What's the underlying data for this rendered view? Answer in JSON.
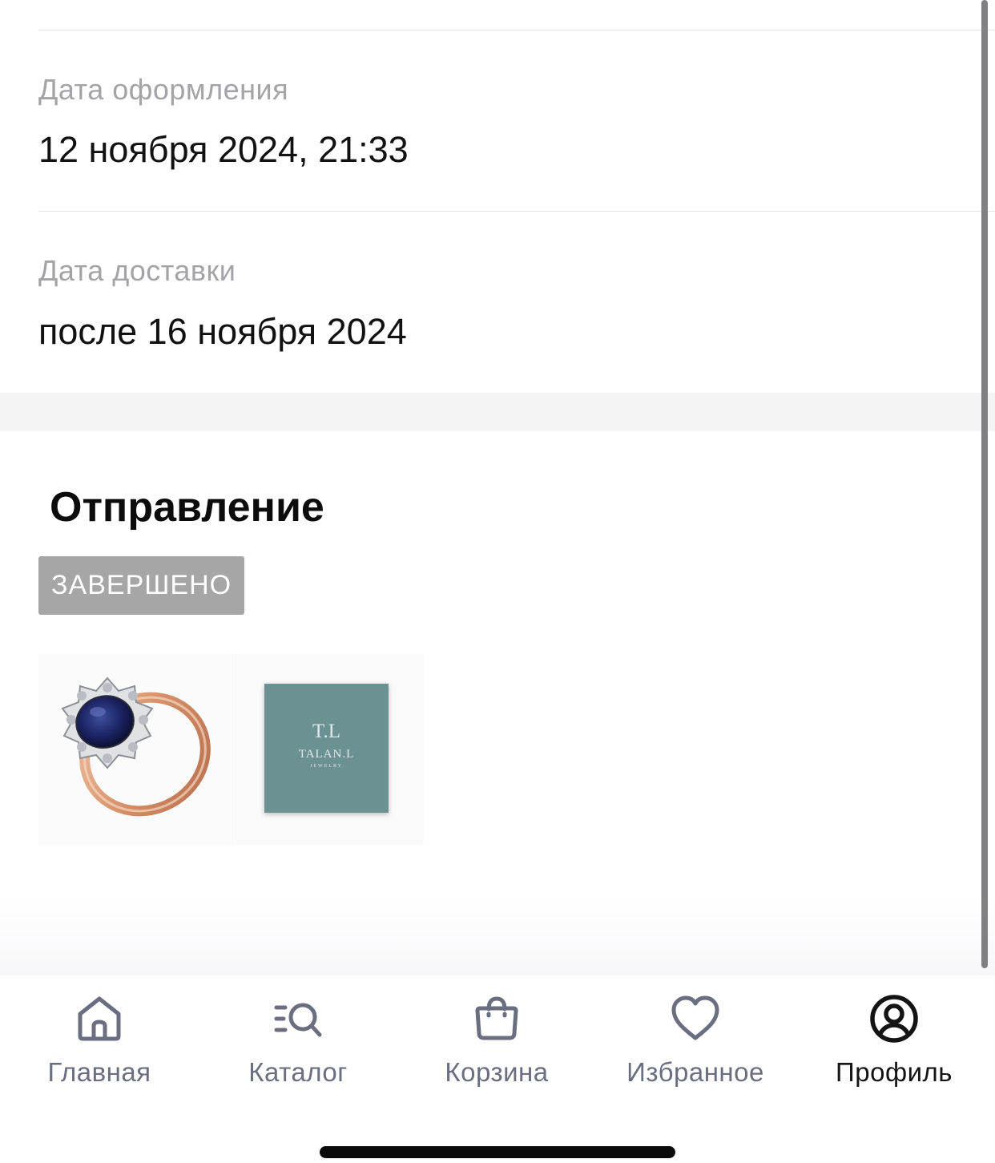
{
  "order_info": {
    "order_date_label": "Дата оформления",
    "order_date_value": "12 ноября 2024, 21:33",
    "delivery_date_label": "Дата доставки",
    "delivery_date_value": "после 16 ноября 2024"
  },
  "shipment": {
    "title": "Отправление",
    "status": "ЗАВЕРШЕНО",
    "items": [
      {
        "icon": "ring-image"
      },
      {
        "icon": "gift-box-image",
        "brand_monogram": "T.L",
        "brand_name": "TALAN.L",
        "brand_sub": "JEWELRY"
      }
    ]
  },
  "tabbar": {
    "items": [
      {
        "label": "Главная",
        "icon": "home-icon",
        "active": false
      },
      {
        "label": "Каталог",
        "icon": "catalog-search-icon",
        "active": false
      },
      {
        "label": "Корзина",
        "icon": "cart-bag-icon",
        "active": false
      },
      {
        "label": "Избранное",
        "icon": "heart-icon",
        "active": false
      },
      {
        "label": "Профиль",
        "icon": "profile-icon",
        "active": true
      }
    ]
  },
  "colors": {
    "tab_inactive": "#6b6e80",
    "tab_active": "#141414",
    "status_badge_bg": "#a6a6a6",
    "box_color": "#6b9193"
  }
}
